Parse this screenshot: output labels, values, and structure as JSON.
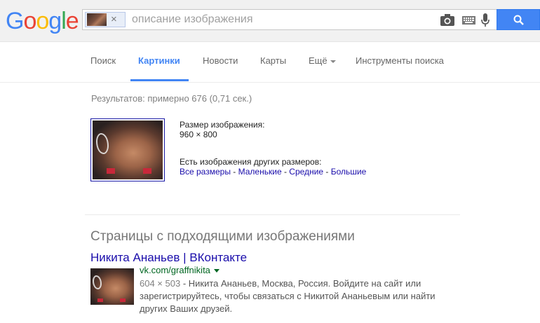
{
  "header": {
    "logo_letters": [
      {
        "ch": "G",
        "color": "#4285f4"
      },
      {
        "ch": "o",
        "color": "#ea4335"
      },
      {
        "ch": "o",
        "color": "#fbbc05"
      },
      {
        "ch": "g",
        "color": "#4285f4"
      },
      {
        "ch": "l",
        "color": "#34a853"
      },
      {
        "ch": "e",
        "color": "#ea4335"
      }
    ],
    "search": {
      "value": "",
      "placeholder": "описание изображения",
      "chip_remove_label": "×"
    },
    "icons": [
      "camera-icon",
      "keyboard-icon",
      "microphone-icon",
      "search-icon"
    ]
  },
  "nav": {
    "items": [
      {
        "label": "Поиск",
        "active": false
      },
      {
        "label": "Картинки",
        "active": true
      },
      {
        "label": "Новости",
        "active": false
      },
      {
        "label": "Карты",
        "active": false
      },
      {
        "label": "Ещё",
        "active": false
      },
      {
        "label": "Инструменты поиска",
        "active": false
      }
    ]
  },
  "results": {
    "stats": "Результатов: примерно 676 (0,71 сек.)",
    "image_size_label": "Размер изображения:",
    "image_size_value": "960 × 800",
    "other_sizes_label": "Есть изображения других размеров:",
    "size_links": [
      "Все размеры",
      "Маленькие",
      "Средние",
      "Большие"
    ],
    "size_separator": " - ",
    "pages_heading": "Страницы с подходящими изображениями",
    "items": [
      {
        "title": "Никита Ананьев | ВКонтакте",
        "url": "vk.com/graffnikita",
        "dims": "604 × 503",
        "snippet": "Никита Ананьев, Москва, Россия. Войдите на сайт или зарегистрируйтесь, чтобы связаться с Никитой Ананьевым или найти других Ваших друзей."
      }
    ]
  },
  "colors": {
    "accent": "#4285f4",
    "link": "#1a0dab",
    "url": "#006621"
  }
}
